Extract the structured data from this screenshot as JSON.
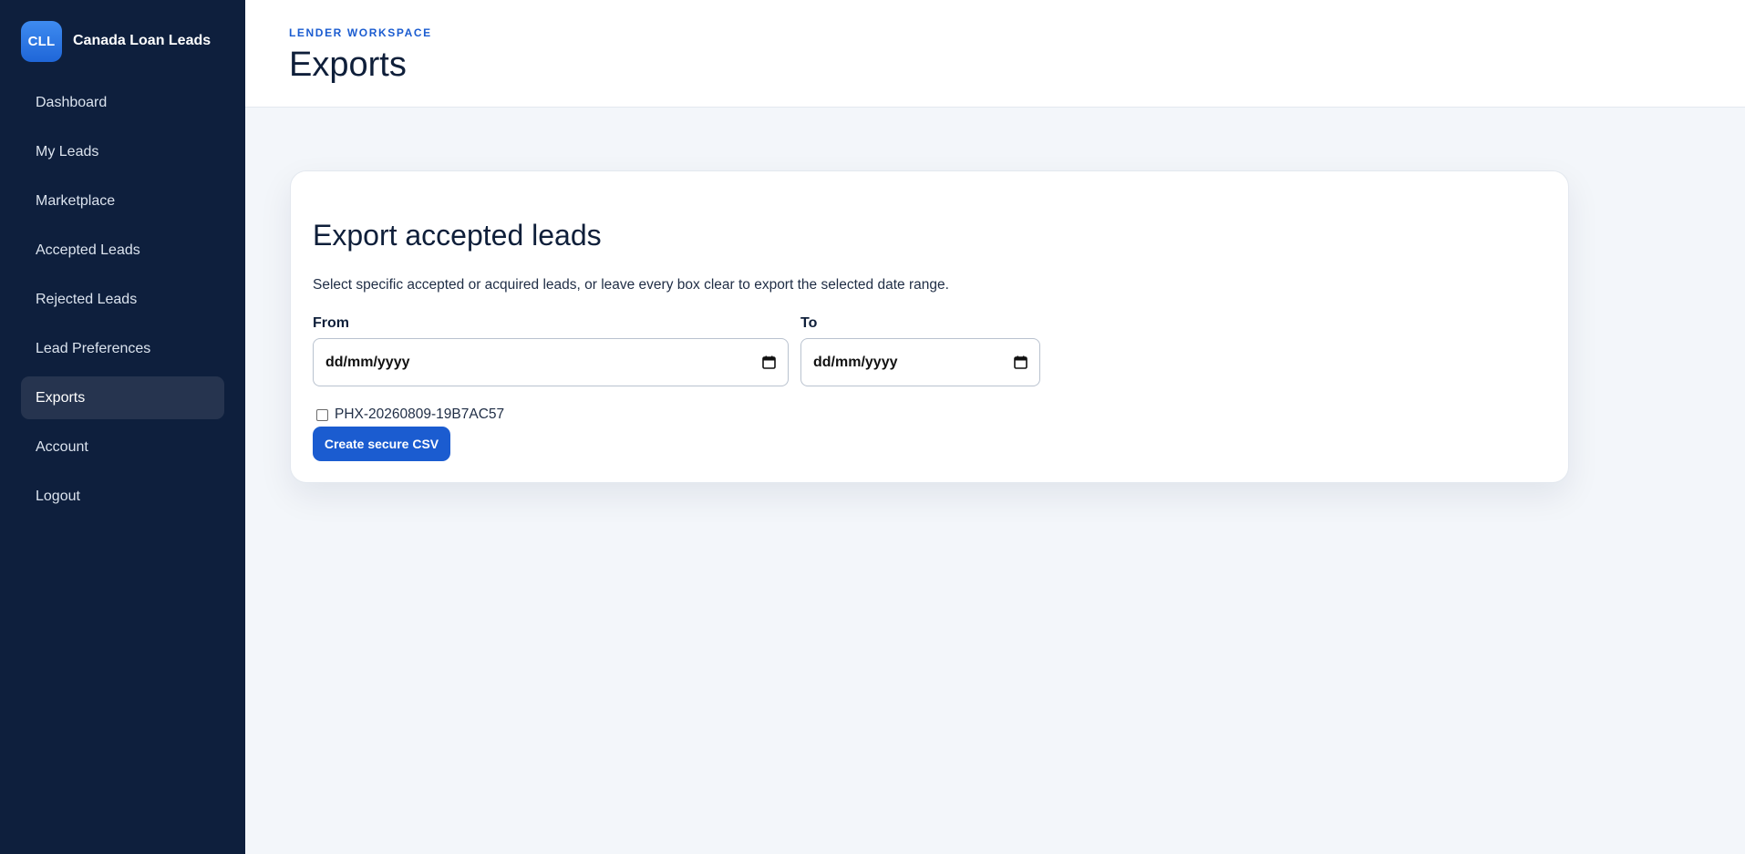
{
  "brand": {
    "logo_text": "CLL",
    "name": "Canada Loan Leads"
  },
  "sidebar": {
    "items": [
      {
        "label": "Dashboard",
        "active": false
      },
      {
        "label": "My Leads",
        "active": false
      },
      {
        "label": "Marketplace",
        "active": false
      },
      {
        "label": "Accepted Leads",
        "active": false
      },
      {
        "label": "Rejected Leads",
        "active": false
      },
      {
        "label": "Lead Preferences",
        "active": false
      },
      {
        "label": "Exports",
        "active": true
      },
      {
        "label": "Account",
        "active": false
      },
      {
        "label": "Logout",
        "active": false
      }
    ]
  },
  "header": {
    "eyebrow": "LENDER WORKSPACE",
    "title": "Exports"
  },
  "export_card": {
    "title": "Export accepted leads",
    "description": "Select specific accepted or acquired leads, or leave every box clear to export the selected date range.",
    "from": {
      "label": "From",
      "placeholder": "dd/mm/yyyy",
      "icon": "calendar-icon"
    },
    "to": {
      "label": "To",
      "placeholder": "dd/mm/yyyy",
      "icon": "calendar-icon"
    },
    "leads": [
      {
        "id": "PHX-20260809-19B7AC57",
        "checked": false
      }
    ],
    "submit_label": "Create secure CSV"
  },
  "colors": {
    "sidebar_bg": "#0e1f3d",
    "sidebar_active": "#26344f",
    "accent": "#1b5cd0",
    "page_bg": "#f3f6fa"
  }
}
